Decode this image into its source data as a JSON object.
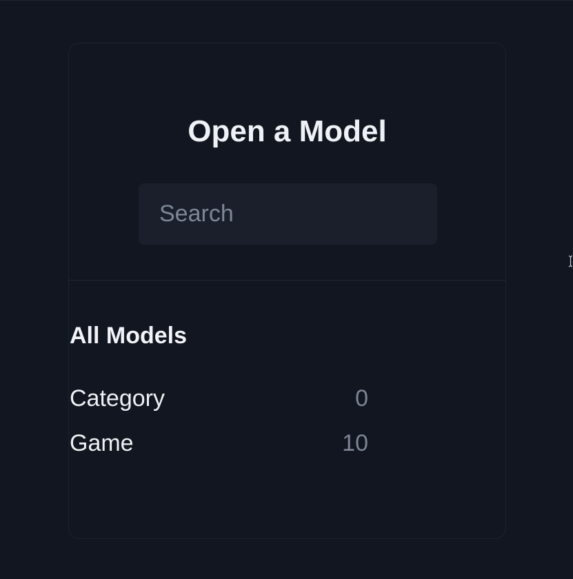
{
  "dialog": {
    "title": "Open a Model"
  },
  "search": {
    "placeholder": "Search",
    "value": ""
  },
  "section": {
    "title": "All Models"
  },
  "models": [
    {
      "label": "Category",
      "count": "0"
    },
    {
      "label": "Game",
      "count": "10"
    }
  ],
  "colors": {
    "background": "#111620",
    "panel_border": "#1d232c",
    "search_bg": "#1a1f2b",
    "text_primary": "#eef0f4",
    "text_muted": "#7d8494"
  },
  "icons": {
    "edge_cursor": "text-cursor-icon"
  }
}
